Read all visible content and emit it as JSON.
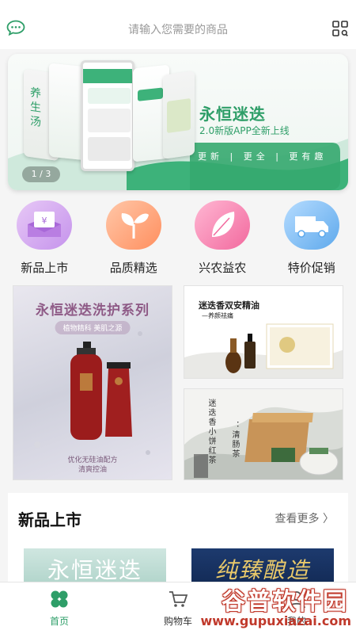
{
  "header": {
    "search_placeholder": "请输入您需要的商品",
    "left_icon": "chat-bubble-icon",
    "right_icon": "scan-icon"
  },
  "banner": {
    "title": "永恒迷迭",
    "subtitle": "2.0新版APP全新上线",
    "tagline": "更新 | 更全 | 更有趣",
    "indicator": "1 / 3",
    "accent_color": "#2e9e68"
  },
  "categories": [
    {
      "label": "新品上市",
      "icon": "ticket-icon",
      "color": "#b77ae0"
    },
    {
      "label": "品质精选",
      "icon": "sprout-icon",
      "color": "#ff8a5c"
    },
    {
      "label": "兴农益农",
      "icon": "leaf-icon",
      "color": "#f06ea0"
    },
    {
      "label": "特价促销",
      "icon": "truck-icon",
      "color": "#5fa8ea"
    }
  ],
  "promos": {
    "left": {
      "title": "永恒迷迭洗护系列",
      "pill": "植物精科 美肌之源",
      "line1": "优化无硅油配方",
      "line2": "清爽控油"
    },
    "right_top": {
      "title": "迷迭香双安精油",
      "subtitle": "—养颜祛痛"
    },
    "right_bottom": {
      "vert1": "迷迭香小饼红茶",
      "vert2": "：清肠茶"
    }
  },
  "new_section": {
    "title": "新品上市",
    "more": "查看更多",
    "cards": [
      {
        "text": "永恒迷迭"
      },
      {
        "text": "纯臻酿造"
      }
    ]
  },
  "bottom_nav": [
    {
      "label": "首页",
      "icon": "clover-icon",
      "active": true
    },
    {
      "label": "购物车",
      "icon": "cart-icon",
      "active": false
    },
    {
      "label": "我的",
      "icon": "user-icon",
      "active": false
    }
  ],
  "watermark": {
    "title": "谷普软件园",
    "url": "www.gupuxiazai.com"
  },
  "colors": {
    "brand_green": "#2e9e68",
    "nav_active": "#2e9e68"
  }
}
